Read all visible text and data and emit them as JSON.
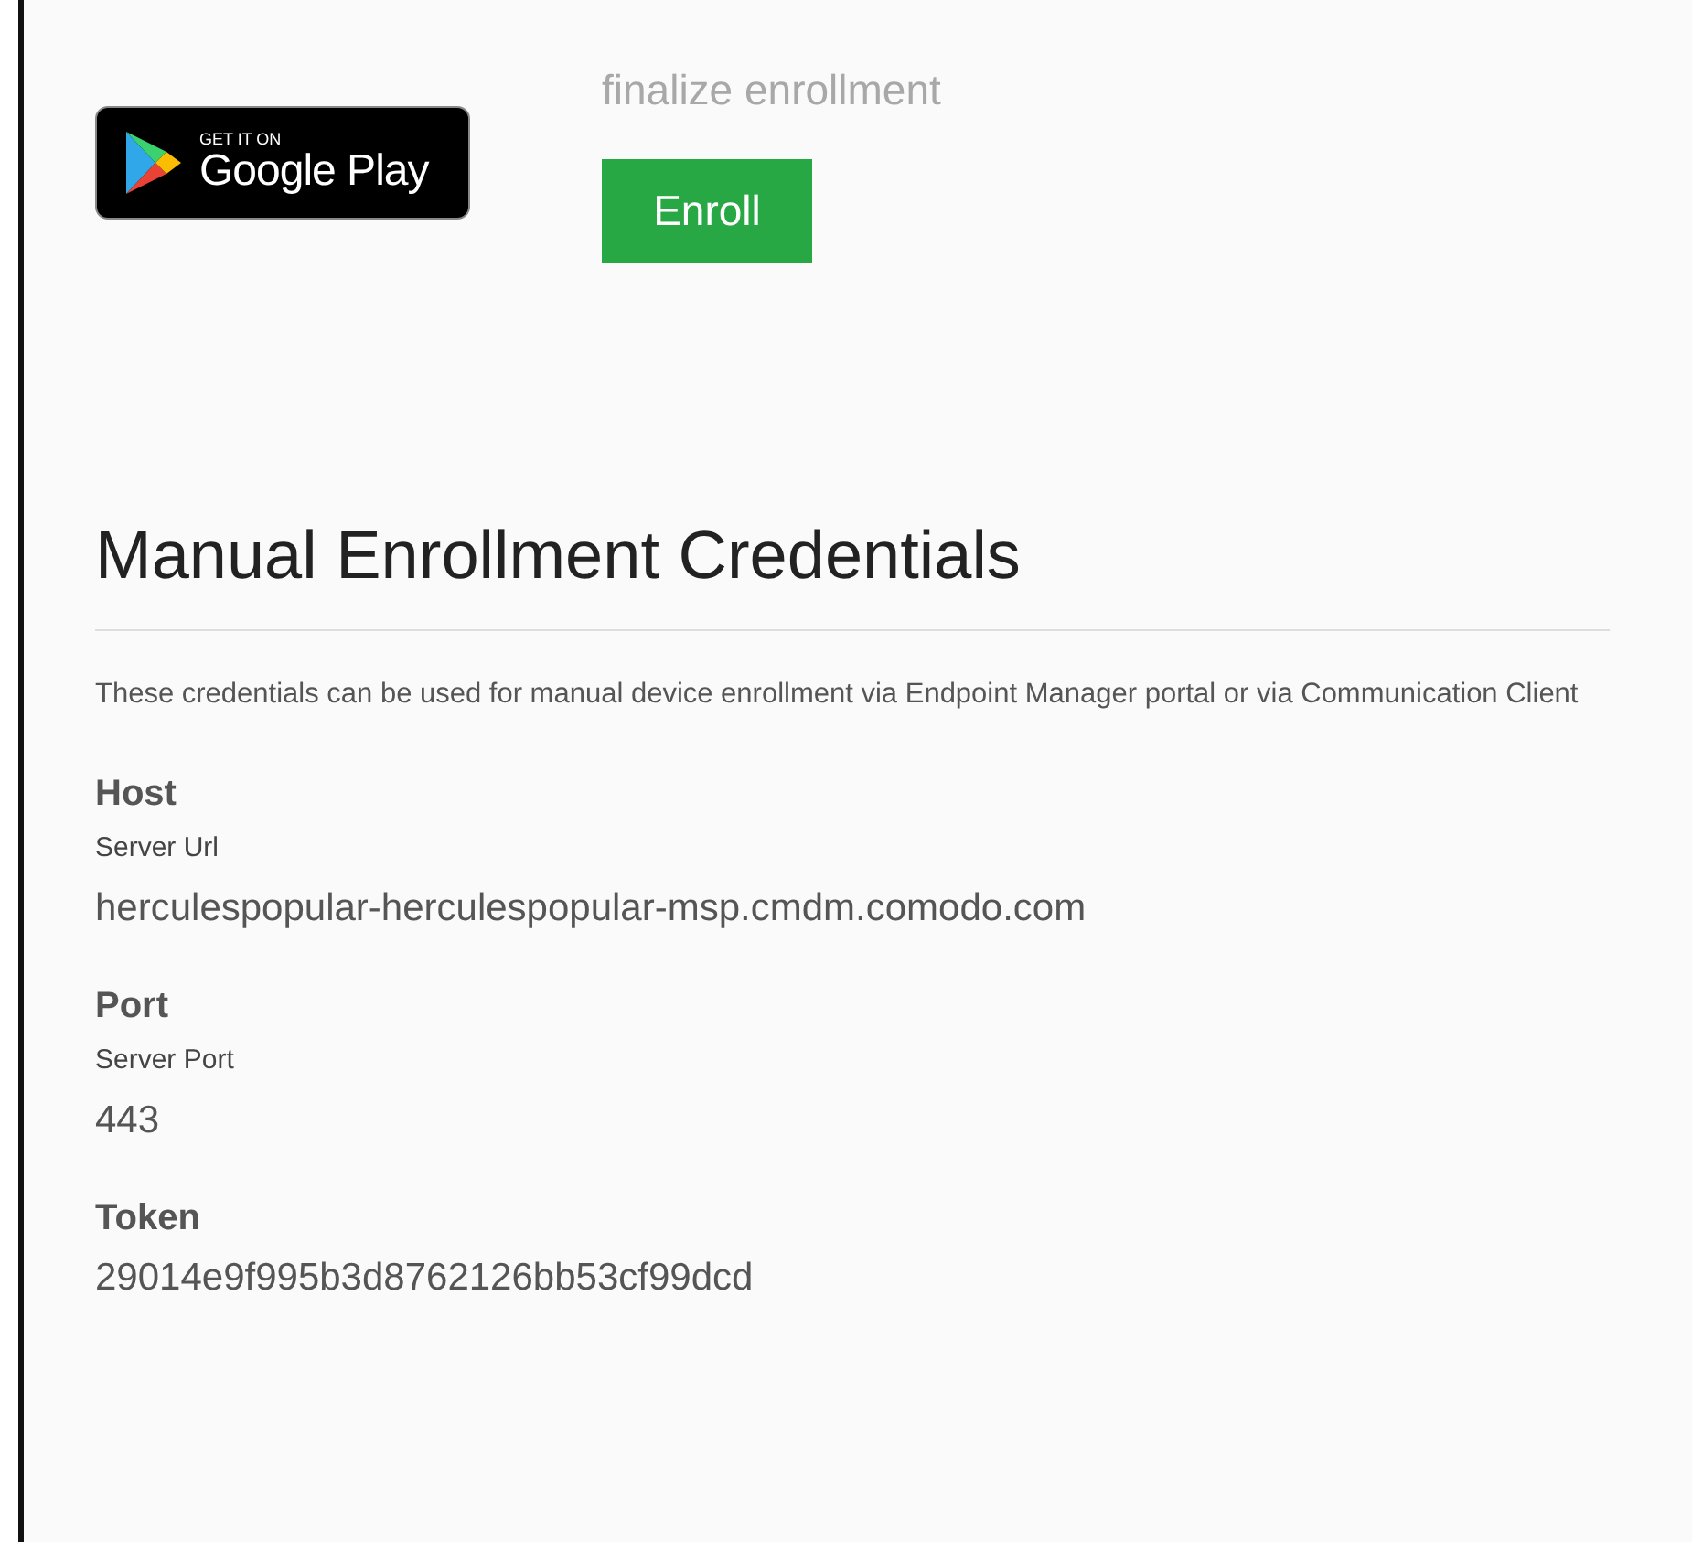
{
  "store_badge": {
    "small_text": "GET IT ON",
    "large_text": "Google Play"
  },
  "enroll": {
    "instruction": "finalize enrollment",
    "button": "Enroll"
  },
  "credentials": {
    "title": "Manual Enrollment Credentials",
    "description": "These credentials can be used for manual device enrollment via Endpoint Manager portal or via Communication Client",
    "fields": [
      {
        "heading": "Host",
        "label": "Server Url",
        "value": "herculespopular-herculespopular-msp.cmdm.comodo.com"
      },
      {
        "heading": "Port",
        "label": "Server Port",
        "value": "443"
      },
      {
        "heading": "Token",
        "value": "29014e9f995b3d8762126bb53cf99dcd"
      }
    ]
  }
}
